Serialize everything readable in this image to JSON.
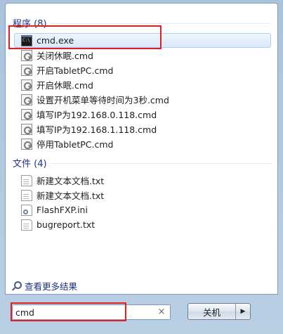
{
  "programs": {
    "header": "程序 (8)",
    "items": [
      {
        "label": "cmd.exe",
        "icon": "cmd-icon",
        "selected": true
      },
      {
        "label": "关闭休眠.cmd",
        "icon": "script-icon"
      },
      {
        "label": "开启TabletPC.cmd",
        "icon": "script-icon"
      },
      {
        "label": "开启休眠.cmd",
        "icon": "script-icon"
      },
      {
        "label": "设置开机菜单等待时间为3秒.cmd",
        "icon": "script-icon"
      },
      {
        "label": "填写IP为192.168.0.118.cmd",
        "icon": "script-icon"
      },
      {
        "label": "填写IP为192.168.1.118.cmd",
        "icon": "script-icon"
      },
      {
        "label": "停用TabletPC.cmd",
        "icon": "script-icon"
      }
    ]
  },
  "files": {
    "header": "文件 (4)",
    "items": [
      {
        "label": "新建文本文档.txt",
        "icon": "text-document-icon"
      },
      {
        "label": "新建文本文档.txt",
        "icon": "text-document-icon"
      },
      {
        "label": "FlashFXP.ini",
        "icon": "settings-file-icon"
      },
      {
        "label": "bugreport.txt",
        "icon": "text-document-icon"
      }
    ]
  },
  "see_more": "查看更多结果",
  "search": {
    "value": "cmd",
    "clear": "×"
  },
  "shutdown": {
    "label": "关机",
    "arrow": "▶"
  },
  "colors": {
    "header_text": "#1e3287",
    "highlight": "#e02020",
    "selection": "#dbe8f9"
  }
}
